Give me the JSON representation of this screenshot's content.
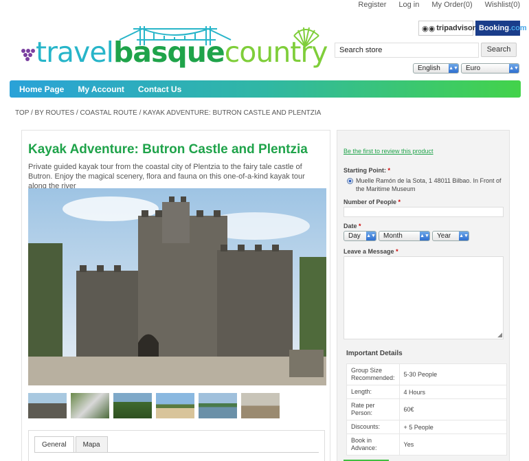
{
  "header": {
    "links": [
      "Register",
      "Log in",
      "My Order(0)",
      "Wishlist(0)"
    ],
    "logo": {
      "part1": "travel",
      "part2": "basque",
      "part3": "country"
    },
    "badges": {
      "tripadvisor": "tripadvisor",
      "booking_part1": "Booking",
      "booking_part2": ".com"
    },
    "search": {
      "value": "Search store",
      "button": "Search"
    },
    "language": "English",
    "currency": "Euro"
  },
  "nav": {
    "items": [
      "Home Page",
      "My Account",
      "Contact Us"
    ]
  },
  "breadcrumb": "TOP / BY ROUTES / COASTAL ROUTE / KAYAK ADVENTURE: BUTRON CASTLE AND PLENTZIA",
  "product": {
    "title": "Kayak Adventure: Butron Castle and Plentzia",
    "description": "Private guided kayak tour from the coastal city of Plentzia to the fairy tale castle of Butron. Enjoy the magical scenery, flora and fauna on this one-of-a-kind kayak tour along the river",
    "tabs": [
      "General",
      "Mapa"
    ]
  },
  "booking": {
    "review_link": "Be the first to review this product",
    "starting_point_label": "Starting Point:",
    "starting_point_value": "Muelle Ramón de la Sota, 1 48011 Bilbao. In Front of the Maritime Museum",
    "people_label": "Number of People",
    "date_label": "Date",
    "day": "Day",
    "month": "Month",
    "year": "Year",
    "message_label": "Leave a Message",
    "required_mark": "*"
  },
  "details": {
    "heading": "Important Details",
    "rows": [
      {
        "key": "Group Size Recommended:",
        "value": "5-30 People"
      },
      {
        "key": "Length:",
        "value": "4 Hours"
      },
      {
        "key": "Rate per Person:",
        "value": "60€"
      },
      {
        "key": "Discounts:",
        "value": "+ 5 People"
      },
      {
        "key": "Book in Advance:",
        "value": "Yes"
      }
    ]
  }
}
